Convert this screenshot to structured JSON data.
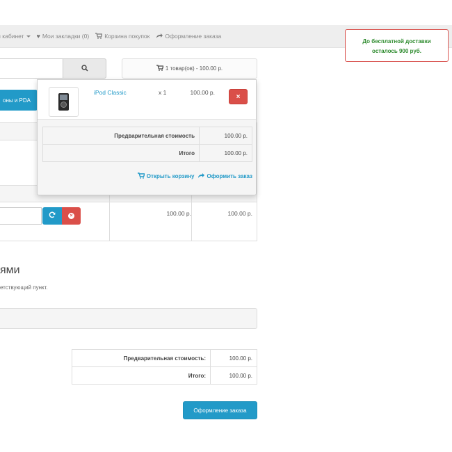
{
  "top_nav": {
    "account": "ый кабинет",
    "wishlist": "Мои закладки (0)",
    "cart": "Корзина покупок",
    "checkout": "Оформление заказа"
  },
  "shipping_notice": {
    "line1": "До бесплатной доставки",
    "line2": "осталось 900 руб.",
    "border_color": "#d9534f",
    "text_color": "#2e8b2e"
  },
  "header": {
    "cart_button": "1 товар(ов) - 100.00 р."
  },
  "menu": {
    "item_label": "оны и PDA"
  },
  "cart_table": {
    "row_unit_price": "100.00 р.",
    "row_total": "100.00 р."
  },
  "section": {
    "title": "ями",
    "subtitle": "етствующий пункт."
  },
  "totals": [
    {
      "label": "Предварительная стоимость:",
      "value": "100.00 р."
    },
    {
      "label": "Итого:",
      "value": "100.00 р."
    }
  ],
  "checkout_button": "Оформление заказа",
  "cart_dropdown": {
    "item": {
      "name": "iPod Classic",
      "qty": "x 1",
      "price": "100.00 р."
    },
    "totals": [
      {
        "label": "Предварительная стоимость",
        "value": "100.00 р."
      },
      {
        "label": "Итого",
        "value": "100.00 р."
      }
    ],
    "open_cart": "Открыть корзину",
    "checkout": "Оформить заказ"
  },
  "colors": {
    "accent": "#229ac8",
    "danger": "#da4f49"
  }
}
